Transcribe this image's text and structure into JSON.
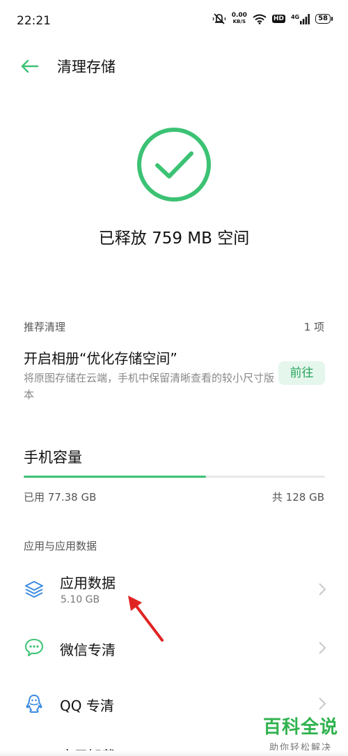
{
  "status_bar": {
    "time": "22:21",
    "net_speed": "0.00",
    "net_unit": "KB/S",
    "hd": "HD",
    "network": "4G",
    "battery": "58"
  },
  "header": {
    "title": "清理存储"
  },
  "result": {
    "freed_text": "已释放 759 MB 空间",
    "icon_color": "#3cc274"
  },
  "recommend": {
    "header": "推荐清理",
    "count": "1 项",
    "title": "开启相册“优化存储空间”",
    "description": "将原图存储在云端，手机中保留清晰查看的较小尺寸版本",
    "button": "前往"
  },
  "capacity": {
    "title": "手机容量",
    "used": "已用 77.38 GB",
    "total": "共 128 GB",
    "used_fraction": 0.6045
  },
  "apps_section": {
    "header": "应用与应用数据",
    "items": [
      {
        "label": "应用数据",
        "sub": "5.10 GB",
        "icon": "layers-icon"
      },
      {
        "label": "微信专清",
        "icon": "wechat-bubble-icon"
      },
      {
        "label": "QQ 专清",
        "icon": "qq-penguin-icon"
      },
      {
        "label": "应用卸载",
        "icon": "app-uninstall-icon"
      }
    ]
  },
  "watermark": {
    "title": "百科全说",
    "subtitle": "助你轻松解决"
  },
  "colors": {
    "accent": "#3cc274",
    "button_bg": "#e5f6ec",
    "button_text": "#27a55c",
    "list_icon": "#3a8be0",
    "annotation_arrow": "#e02424"
  }
}
